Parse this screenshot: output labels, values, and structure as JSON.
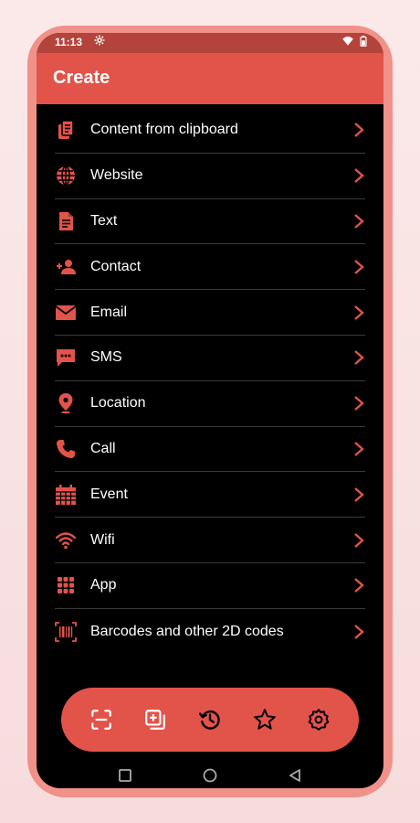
{
  "status": {
    "time": "11:13"
  },
  "appbar": {
    "title": "Create"
  },
  "list": [
    {
      "label": "Content from clipboard",
      "icon": "clipboard-icon"
    },
    {
      "label": "Website",
      "icon": "globe-icon"
    },
    {
      "label": "Text",
      "icon": "document-icon"
    },
    {
      "label": "Contact",
      "icon": "add-person-icon"
    },
    {
      "label": "Email",
      "icon": "envelope-icon"
    },
    {
      "label": "SMS",
      "icon": "chat-icon"
    },
    {
      "label": "Location",
      "icon": "location-pin-icon"
    },
    {
      "label": "Call",
      "icon": "phone-icon"
    },
    {
      "label": "Event",
      "icon": "calendar-icon"
    },
    {
      "label": "Wifi",
      "icon": "wifi-icon"
    },
    {
      "label": "App",
      "icon": "apps-grid-icon"
    },
    {
      "label": "Barcodes and other 2D codes",
      "icon": "barcode-icon"
    }
  ],
  "bottom_nav": [
    "scan-icon",
    "create-icon",
    "history-icon",
    "favorites-icon",
    "settings-icon"
  ],
  "colors": {
    "accent": "#e2534a",
    "statusbar": "#b4433b",
    "frame": "#f0918a"
  }
}
